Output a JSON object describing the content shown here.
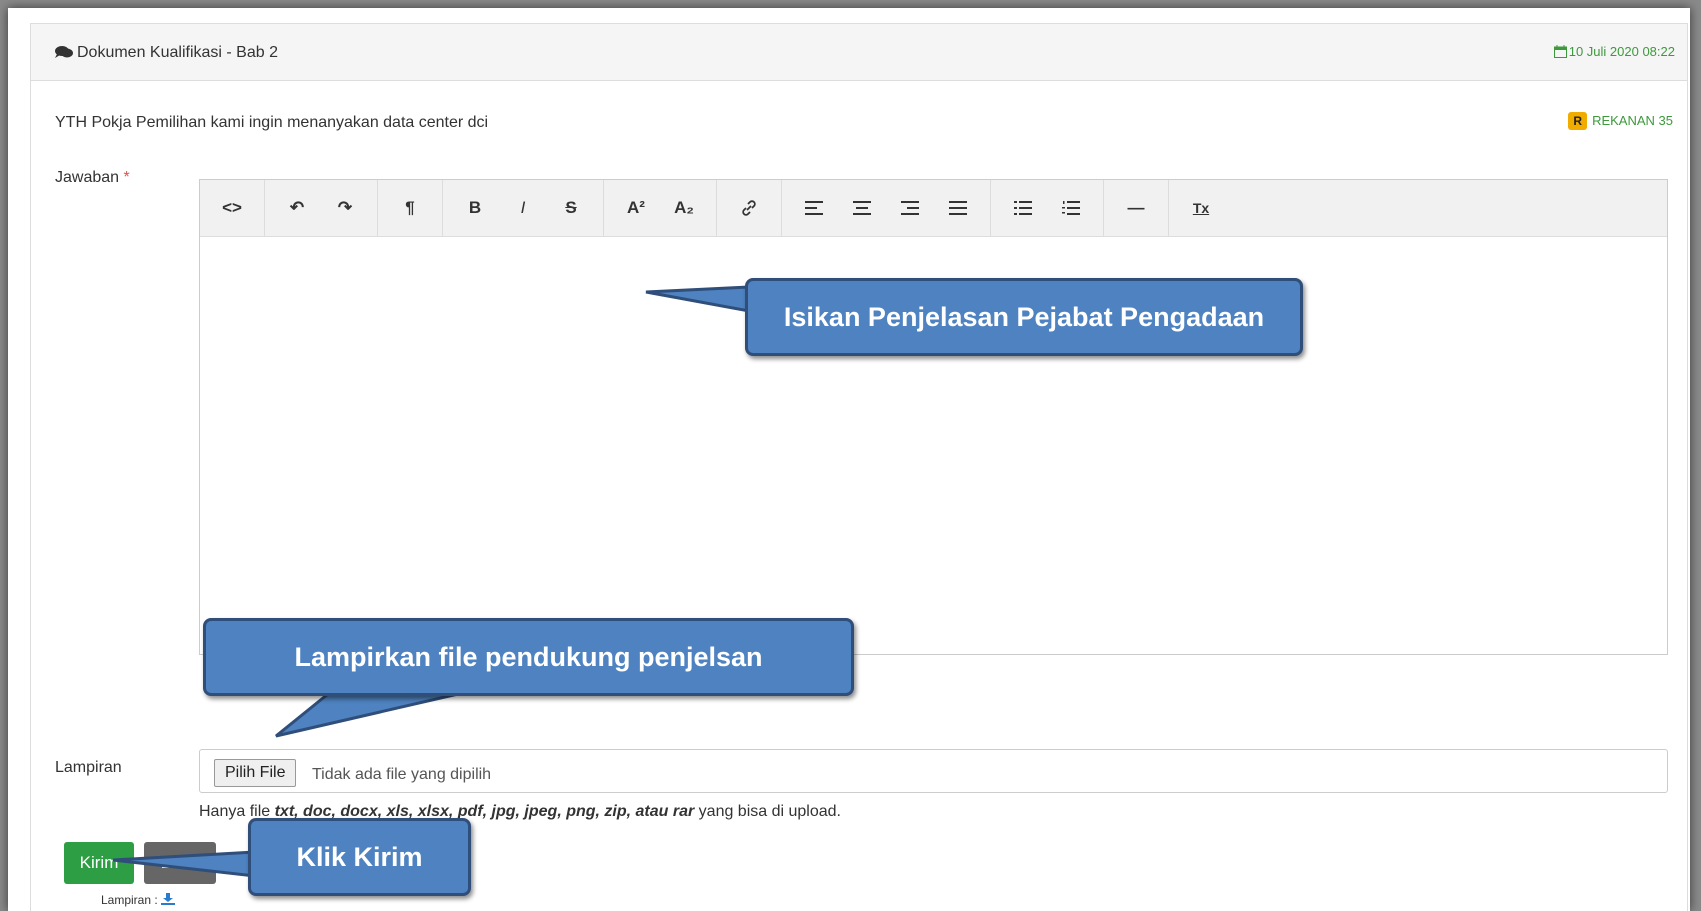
{
  "header": {
    "title": "Dokumen Kualifikasi - Bab 2",
    "date": "10 Juli 2020 08:22"
  },
  "question": {
    "text": "YTH Pokja Pemilihan kami ingin menanyakan data center dci",
    "badge": "R",
    "sender": "REKANAN 35"
  },
  "form": {
    "jawaban_label": "Jawaban",
    "required_mark": "*",
    "toolbar": {
      "code": "<>",
      "undo": "↶",
      "redo": "↷",
      "paragraph": "¶",
      "bold": "B",
      "italic": "I",
      "strike": "S",
      "superscript": "A²",
      "subscript": "A₂",
      "link": "🔗",
      "align_left": "≡",
      "align_center": "≡",
      "align_right": "≡",
      "justify": "≡",
      "ul": "☰",
      "ol": "☰",
      "hr": "—",
      "clear": "Tx"
    },
    "lampiran_label": "Lampiran",
    "file_button": "Pilih File",
    "file_status": "Tidak ada file yang dipilih",
    "hint_prefix": "Hanya file ",
    "hint_types": "txt, doc, docx, xls, xlsx, pdf, jpg, jpeg, png, zip, atau rar",
    "hint_suffix": " yang bisa di upload.",
    "submit": "Kirim",
    "cancel": "Batal",
    "lampiran_small": "Lampiran :"
  },
  "callouts": {
    "editor": "Isikan Penjelasan Pejabat Pengadaan",
    "attachment": "Lampirkan file pendukung penjelsan",
    "submit": "Klik Kirim"
  },
  "colors": {
    "accent_green": "#2e9e44",
    "callout_blue": "#4e82c0",
    "badge_yellow": "#f0ad00"
  }
}
